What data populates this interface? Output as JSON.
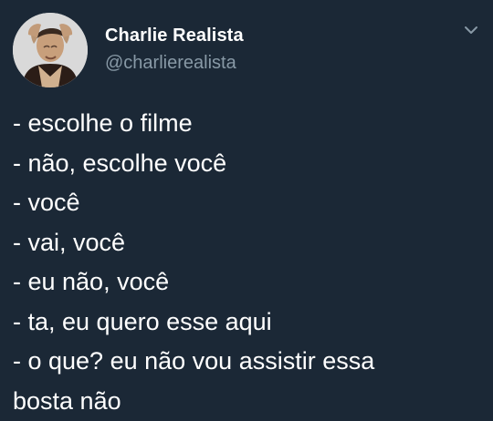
{
  "author": {
    "name": "Charlie Realista",
    "handle": "@charlierealista"
  },
  "icons": {
    "menu": "chevron-down-icon",
    "avatar": "profile-photo"
  },
  "colors": {
    "background": "#1b2836",
    "text": "#ffffff",
    "secondary_text": "#8899a6"
  },
  "tweet": {
    "lines": [
      "- escolhe o filme",
      "- não, escolhe você",
      "- você",
      "- vai, você",
      "- eu não, você",
      "- ta, eu quero esse aqui",
      "- o que? eu não vou assistir essa",
      "bosta não"
    ]
  }
}
